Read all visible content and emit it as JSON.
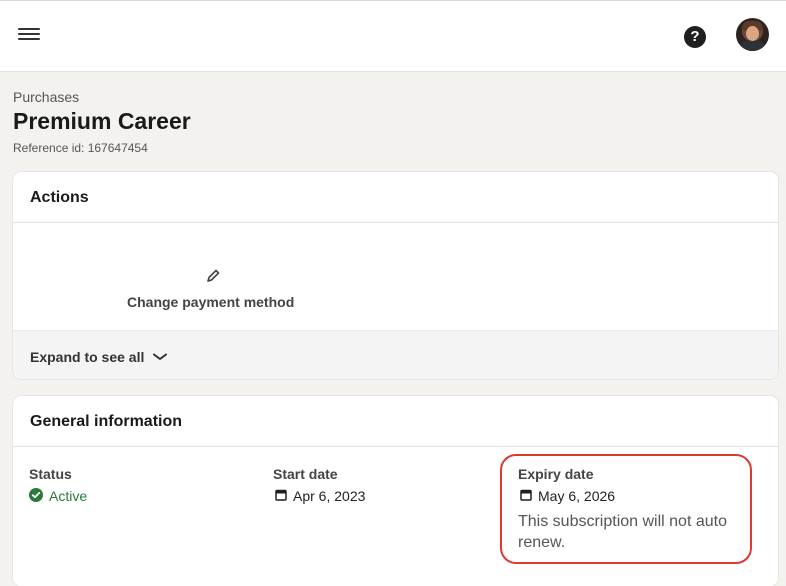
{
  "header": {
    "menu_icon": "hamburger-menu-icon",
    "help_icon": "question-circle-icon",
    "help_glyph": "?",
    "avatar": "user-avatar"
  },
  "page": {
    "breadcrumb": "Purchases",
    "title": "Premium Career",
    "reference": "Reference id: 167647454"
  },
  "actions_card": {
    "title": "Actions",
    "items": [
      {
        "label": "Change payment method",
        "icon": "pencil-icon"
      }
    ],
    "expand_label": "Expand to see all",
    "expand_icon": "chevron-down-icon"
  },
  "general_card": {
    "title": "General information",
    "status": {
      "label": "Status",
      "value": "Active",
      "icon": "check-circle-icon",
      "color": "#2b7a3b"
    },
    "start_date": {
      "label": "Start date",
      "value": "Apr 6, 2023",
      "icon": "calendar-icon"
    },
    "expiry_date": {
      "label": "Expiry date",
      "value": "May 6, 2026",
      "icon": "calendar-icon",
      "note": "This subscription will not auto renew."
    }
  },
  "colors": {
    "accent_green": "#2b7a3b",
    "highlight_red": "#e0392f",
    "background": "#f3f2ef"
  }
}
